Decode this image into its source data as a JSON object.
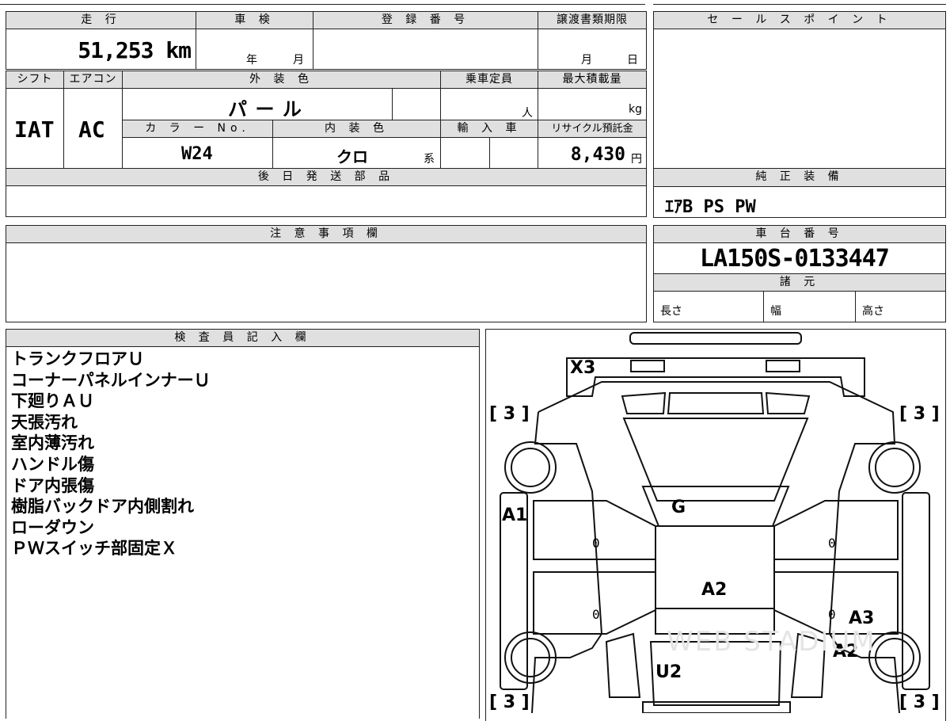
{
  "top_panel": {
    "mileage_header": "走 行",
    "mileage": "51,253 km",
    "inspection_header": "車 検",
    "inspection_year_label": "年",
    "inspection_month_label": "月",
    "registration_header": "登 録 番 号",
    "transfer_deadline_header": "譲渡書類期限",
    "transfer_month_label": "月",
    "transfer_day_label": "日",
    "shift_header": "シフト",
    "shift": "IAT",
    "ac_header": "エアコン",
    "ac": "AC",
    "exterior_color_header": "外 装 色",
    "exterior_color": "パ ー ル",
    "capacity_header": "乗車定員",
    "capacity_unit": "人",
    "max_load_header": "最大積載量",
    "max_load_unit": "kg",
    "color_no_header": "カ ラ ー No.",
    "color_no": "W24",
    "interior_color_header": "内 装 色",
    "interior_color": "クロ",
    "interior_suffix": "系",
    "import_header": "輸 入 車",
    "recycle_header": "リサイクル預託金",
    "recycle_fee": "8,430",
    "recycle_unit": "円",
    "parts_header": "後 日 発 送 部 品",
    "notes_header": "注 意 事 項 欄"
  },
  "side_panel": {
    "sales_point_header": "セ ー ル ス ポ イ ン ト",
    "genuine_equipment_header": "純 正 装 備",
    "genuine_equipment": "ｴｱB PS PW",
    "chassis_header": "車 台 番 号",
    "chassis_number": "LA150S-0133447",
    "specs_header": "諸 元",
    "length_label": "長さ",
    "width_label": "幅",
    "height_label": "高さ"
  },
  "inspector": {
    "header": "検 査 員 記 入 欄",
    "lines": [
      "トランクフロアＵ",
      "コーナーパネルインナーＵ",
      "下廻りＡＵ",
      "天張汚れ",
      "室内薄汚れ",
      "ハンドル傷",
      "ドア内張傷",
      "樹脂バックドア内側割れ",
      "ローダウン",
      "ＰＷスイッチ部固定Ｘ"
    ]
  },
  "diagram": {
    "marks": {
      "rear": "X3",
      "tire_tl": "[ 3 ]",
      "tire_tr": "[ 3 ]",
      "tire_bl": "[ 3 ]",
      "tire_br": "[ 3 ]",
      "left_side": "A1",
      "glass": "G",
      "roof": "A2",
      "right_door": "A3",
      "right_fender": "A2",
      "hood": "U2",
      "door_zero": "0"
    },
    "watermark": "WEB STADIUM"
  }
}
